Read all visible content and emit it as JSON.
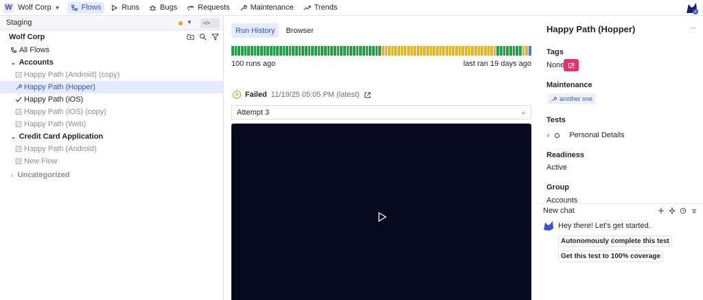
{
  "workspace": {
    "initial": "W",
    "name": "Wolf Corp"
  },
  "nav": [
    {
      "label": "Flows",
      "icon": "flows-icon",
      "active": true
    },
    {
      "label": "Runs",
      "icon": "play-icon"
    },
    {
      "label": "Bugs",
      "icon": "bug-icon"
    },
    {
      "label": "Requests",
      "icon": "requests-icon"
    },
    {
      "label": "Maintenance",
      "icon": "wrench-icon"
    },
    {
      "label": "Trends",
      "icon": "trend-icon"
    }
  ],
  "left": {
    "environment": "Staging",
    "code_button": "</>",
    "org": "Wolf Corp",
    "all_flows": "All Flows",
    "groups": [
      {
        "name": "Accounts",
        "items": [
          {
            "label": "Happy Path (Android) (copy)",
            "icon": "edit-icon",
            "state": "draft"
          },
          {
            "label": "Happy Path (Hopper)",
            "icon": "wrench-icon",
            "state": "selected"
          },
          {
            "label": "Happy Path (iOS)",
            "icon": "check-icon",
            "state": "active"
          },
          {
            "label": "Happy Path (iOS) (copy)",
            "icon": "edit-icon",
            "state": "draft"
          },
          {
            "label": "Happy Path (Web)",
            "icon": "edit-icon",
            "state": "draft"
          }
        ]
      },
      {
        "name": "Credit Card Application",
        "items": [
          {
            "label": "Happy Path (Android)",
            "icon": "edit-icon",
            "state": "draft"
          },
          {
            "label": "New Flow",
            "icon": "edit-icon",
            "state": "draft"
          }
        ]
      }
    ],
    "uncategorized": "Uncategorized"
  },
  "center": {
    "tabs": [
      "Run History",
      "Browser"
    ],
    "run_history": "gggggggggggggggggggggggggggggggggggggggggggggggyyyyyyyyyyyyyyyyyyyyyyyyyyyyyyyyyyyyggggggggyyb",
    "colors": {
      "pass": "#22a046",
      "fail": "#e6b326",
      "latest": "#3d7bf0"
    },
    "runs_ago": "100 runs ago",
    "last_ran": "last ran 19 days ago",
    "status": "Failed",
    "status_time": "11/19/25 05:05 PM (latest)",
    "attempt": "Attempt 3"
  },
  "right": {
    "title": "Happy Path (Hopper)",
    "tags_label": "Tags",
    "tags_value": "None",
    "maintenance_label": "Maintenance",
    "maintenance_chip": "another one",
    "tests_label": "Tests",
    "test_name": "Personal Details",
    "readiness_label": "Readiness",
    "readiness_value": "Active",
    "group_label": "Group",
    "group_value": "Accounts",
    "chat_title": "New chat",
    "bot_message": "Hey there! Let's get started.",
    "suggestions": [
      "Autonomously complete this test",
      "Get this test to 100% coverage"
    ]
  }
}
